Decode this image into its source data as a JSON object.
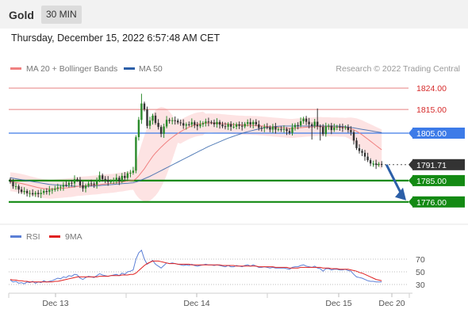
{
  "header": {
    "symbol": "Gold",
    "timeframe": "30 MIN",
    "datetime": "Thursday, December 15, 2022 6:57:48 AM CET"
  },
  "legend": {
    "ma20": "MA 20 + Bollinger Bands",
    "ma50": "MA 50",
    "credit": "Research © 2022 Trading Central",
    "rsi": "RSI",
    "rsi_ma": "9MA"
  },
  "colors": {
    "ma20": "#f08080",
    "ma50": "#2c5fa8",
    "band_fill": "#fde0e0",
    "resistance": "#e88080",
    "pivot": "#3d7be8",
    "support": "#138a13",
    "current": "#333333",
    "candle_up": "#2a8a2a",
    "candle_down": "#333333",
    "arrow": "#2c5fa8",
    "rsi": "#5b7fd6",
    "rsi_ma": "#e02020"
  },
  "chart_data": [
    {
      "type": "candlestick",
      "title": "Gold",
      "timeframe": "30 MIN",
      "x_ticks": [
        "Dec 13",
        "Dec 14",
        "Dec 15",
        "Dec 20"
      ],
      "levels": [
        {
          "value": 1824.0,
          "label": "1824.00",
          "kind": "resistance"
        },
        {
          "value": 1815.0,
          "label": "1815.00",
          "kind": "resistance"
        },
        {
          "value": 1805.0,
          "label": "1805.00",
          "kind": "pivot"
        },
        {
          "value": 1791.71,
          "label": "1791.71",
          "kind": "current"
        },
        {
          "value": 1785.0,
          "label": "1785.00",
          "kind": "support"
        },
        {
          "value": 1776.0,
          "label": "1776.00",
          "kind": "support"
        }
      ],
      "close": [
        1784.5,
        1782.6,
        1782.6,
        1781.2,
        1780.2,
        1780.6,
        1779.7,
        1779.7,
        1779.2,
        1779.8,
        1779.3,
        1779.8,
        1780.6,
        1780.2,
        1781.1,
        1781.1,
        1781.6,
        1782.1,
        1782.4,
        1783.2,
        1783.1,
        1784.1,
        1783.8,
        1785.6,
        1785.3,
        1783.0,
        1781.7,
        1782.9,
        1783.8,
        1783.7,
        1783.3,
        1785.1,
        1787.2,
        1785.7,
        1785.3,
        1784.5,
        1784.7,
        1785.1,
        1786.2,
        1784.8,
        1787.0,
        1786.1,
        1788.1,
        1788.3,
        1789.2,
        1803.3,
        1810.6,
        1817.5,
        1815.0,
        1808.1,
        1810.3,
        1812.4,
        1809.3,
        1807.6,
        1804.7,
        1807.8,
        1810.6,
        1810.1,
        1810.4,
        1810.3,
        1809.5,
        1809.2,
        1808.2,
        1808.7,
        1808.6,
        1809.6,
        1808.5,
        1807.9,
        1808.7,
        1809.2,
        1809.9,
        1809.6,
        1809.5,
        1808.7,
        1809.7,
        1808.6,
        1807.9,
        1807.7,
        1808.8,
        1807.7,
        1807.7,
        1808.7,
        1808.1,
        1807.8,
        1808.9,
        1809.6,
        1808.7,
        1809.7,
        1808.7,
        1807.2,
        1807.1,
        1807.6,
        1807.4,
        1806.5,
        1807.7,
        1806.5,
        1806.7,
        1806.6,
        1806.7,
        1805.9,
        1805.1,
        1807.5,
        1808.4,
        1808.3,
        1810.0,
        1811.1,
        1809.8,
        1808.7,
        1808.1,
        1809.8,
        1807.9,
        1807.6,
        1804.6,
        1807.8,
        1808.1,
        1806.3,
        1807.4,
        1807.7,
        1807.4,
        1807.2,
        1807.5,
        1806.3,
        1805.4,
        1801.9,
        1798.7,
        1797.5,
        1796.7,
        1795.1,
        1793.6,
        1792.2,
        1792.2,
        1791.6,
        1792.0,
        1791.7
      ],
      "ma20": [
        1784.5,
        1784.4,
        1784.2,
        1784.0,
        1783.8,
        1783.5,
        1783.2,
        1782.9,
        1782.6,
        1782.3,
        1782.0,
        1781.8,
        1781.6,
        1781.5,
        1781.4,
        1781.4,
        1781.5,
        1781.6,
        1781.7,
        1781.8,
        1781.9,
        1782.0,
        1782.1,
        1782.3,
        1782.5,
        1782.6,
        1782.7,
        1782.8,
        1782.9,
        1783.0,
        1783.1,
        1783.2,
        1783.3,
        1783.5,
        1783.6,
        1783.7,
        1783.8,
        1783.9,
        1784.1,
        1784.3,
        1784.4,
        1784.6,
        1784.8,
        1785.0,
        1785.1,
        1785.8,
        1787.0,
        1788.5,
        1790.0,
        1791.8,
        1793.5,
        1795.2,
        1796.6,
        1797.9,
        1799.1,
        1800.2,
        1801.3,
        1802.3,
        1803.2,
        1804.1,
        1804.9,
        1805.6,
        1806.3,
        1806.9,
        1807.5,
        1808.0,
        1808.4,
        1808.7,
        1808.9,
        1809.1,
        1809.2,
        1809.3,
        1809.3,
        1809.2,
        1809.2,
        1809.1,
        1809.0,
        1808.9,
        1808.8,
        1808.7,
        1808.6,
        1808.5,
        1808.4,
        1808.4,
        1808.3,
        1808.3,
        1808.3,
        1808.2,
        1808.2,
        1808.1,
        1808.0,
        1807.9,
        1807.8,
        1807.7,
        1807.6,
        1807.5,
        1807.4,
        1807.3,
        1807.2,
        1807.1,
        1807.0,
        1807.0,
        1807.1,
        1807.2,
        1807.3,
        1807.4,
        1807.5,
        1807.6,
        1807.6,
        1807.7,
        1807.8,
        1807.8,
        1807.7,
        1807.7,
        1807.7,
        1807.6,
        1807.6,
        1807.6,
        1807.5,
        1807.5,
        1807.4,
        1807.2,
        1806.9,
        1806.4,
        1805.8,
        1805.1,
        1804.3,
        1803.4,
        1802.5,
        1801.6,
        1800.7,
        1799.8,
        1798.9,
        1798.0
      ],
      "ma50": [
        1786.2,
        1786.0,
        1785.8,
        1785.6,
        1785.4,
        1785.2,
        1785.0,
        1784.8,
        1784.6,
        1784.4,
        1784.2,
        1784.0,
        1783.8,
        1783.6,
        1783.4,
        1783.3,
        1783.2,
        1783.1,
        1783.0,
        1782.9,
        1782.8,
        1782.7,
        1782.7,
        1782.6,
        1782.6,
        1782.6,
        1782.6,
        1782.6,
        1782.6,
        1782.7,
        1782.7,
        1782.8,
        1782.9,
        1783.0,
        1783.1,
        1783.2,
        1783.3,
        1783.4,
        1783.5,
        1783.6,
        1783.7,
        1783.8,
        1783.9,
        1784.0,
        1784.1,
        1784.4,
        1784.8,
        1785.3,
        1785.8,
        1786.3,
        1786.8,
        1787.4,
        1788.0,
        1788.6,
        1789.2,
        1789.8,
        1790.4,
        1791.0,
        1791.6,
        1792.2,
        1792.8,
        1793.4,
        1794.0,
        1794.6,
        1795.2,
        1795.8,
        1796.4,
        1797.0,
        1797.6,
        1798.2,
        1798.8,
        1799.4,
        1799.9,
        1800.4,
        1800.9,
        1801.4,
        1801.9,
        1802.4,
        1802.9,
        1803.3,
        1803.7,
        1804.1,
        1804.5,
        1804.9,
        1805.3,
        1805.6,
        1805.9,
        1806.2,
        1806.5,
        1806.8,
        1807.0,
        1807.2,
        1807.4,
        1807.6,
        1807.7,
        1807.8,
        1807.9,
        1808.0,
        1808.0,
        1808.0,
        1808.0,
        1808.0,
        1808.0,
        1808.0,
        1808.0,
        1808.0,
        1808.0,
        1808.0,
        1808.0,
        1808.0,
        1808.0,
        1808.0,
        1808.0,
        1808.0,
        1808.0,
        1808.0,
        1808.0,
        1808.0,
        1807.9,
        1807.8,
        1807.7,
        1807.6,
        1807.4,
        1807.2,
        1807.0,
        1806.8,
        1806.6,
        1806.4,
        1806.2,
        1806.0,
        1805.8,
        1805.6,
        1805.4,
        1805.2
      ],
      "forecast": {
        "from": 1791.71,
        "to": 1776.0
      }
    },
    {
      "type": "line",
      "title": "RSI",
      "series": [
        {
          "name": "RSI"
        },
        {
          "name": "9MA"
        }
      ],
      "y_ticks": [
        70,
        50,
        30
      ],
      "rsi": [
        37,
        34,
        35,
        32,
        33,
        31,
        34,
        33,
        35,
        32,
        34,
        33,
        36,
        34,
        35,
        36,
        38,
        40,
        39,
        42,
        41,
        44,
        43,
        46,
        45,
        40,
        38,
        41,
        43,
        42,
        41,
        44,
        47,
        45,
        44,
        43,
        44,
        45,
        46,
        44,
        48,
        46,
        50,
        51,
        53,
        70,
        80,
        84,
        70,
        62,
        65,
        68,
        62,
        59,
        56,
        60,
        64,
        63,
        64,
        63,
        62,
        61,
        60,
        61,
        60,
        62,
        60,
        59,
        60,
        61,
        62,
        61,
        61,
        60,
        61,
        60,
        59,
        58,
        60,
        58,
        58,
        60,
        59,
        58,
        60,
        61,
        59,
        61,
        59,
        57,
        57,
        58,
        57,
        56,
        57,
        56,
        56,
        56,
        56,
        55,
        54,
        57,
        58,
        58,
        60,
        61,
        59,
        58,
        57,
        59,
        56,
        55,
        51,
        55,
        55,
        53,
        54,
        54,
        53,
        53,
        54,
        52,
        51,
        46,
        42,
        41,
        40,
        38,
        36,
        35,
        35,
        34,
        34,
        34
      ],
      "ma9": [
        38,
        37,
        37,
        36,
        36,
        35,
        35,
        34,
        34,
        34,
        34,
        34,
        34,
        34,
        34,
        34,
        35,
        35,
        36,
        37,
        38,
        39,
        40,
        41,
        42,
        42,
        42,
        42,
        42,
        42,
        42,
        42,
        43,
        43,
        43,
        43,
        44,
        44,
        44,
        44,
        45,
        45,
        45,
        46,
        46,
        48,
        52,
        56,
        60,
        63,
        65,
        67,
        67,
        67,
        66,
        65,
        64,
        63,
        63,
        63,
        62,
        62,
        62,
        62,
        62,
        61,
        61,
        61,
        61,
        61,
        61,
        61,
        61,
        61,
        61,
        61,
        60,
        60,
        60,
        60,
        60,
        59,
        59,
        59,
        59,
        59,
        59,
        59,
        59,
        58,
        58,
        58,
        58,
        58,
        58,
        57,
        57,
        57,
        57,
        57,
        56,
        56,
        56,
        56,
        57,
        57,
        57,
        57,
        57,
        57,
        57,
        57,
        56,
        56,
        56,
        55,
        55,
        55,
        54,
        54,
        54,
        54,
        53,
        52,
        51,
        49,
        48,
        46,
        44,
        42,
        40,
        38,
        37,
        36
      ]
    }
  ]
}
